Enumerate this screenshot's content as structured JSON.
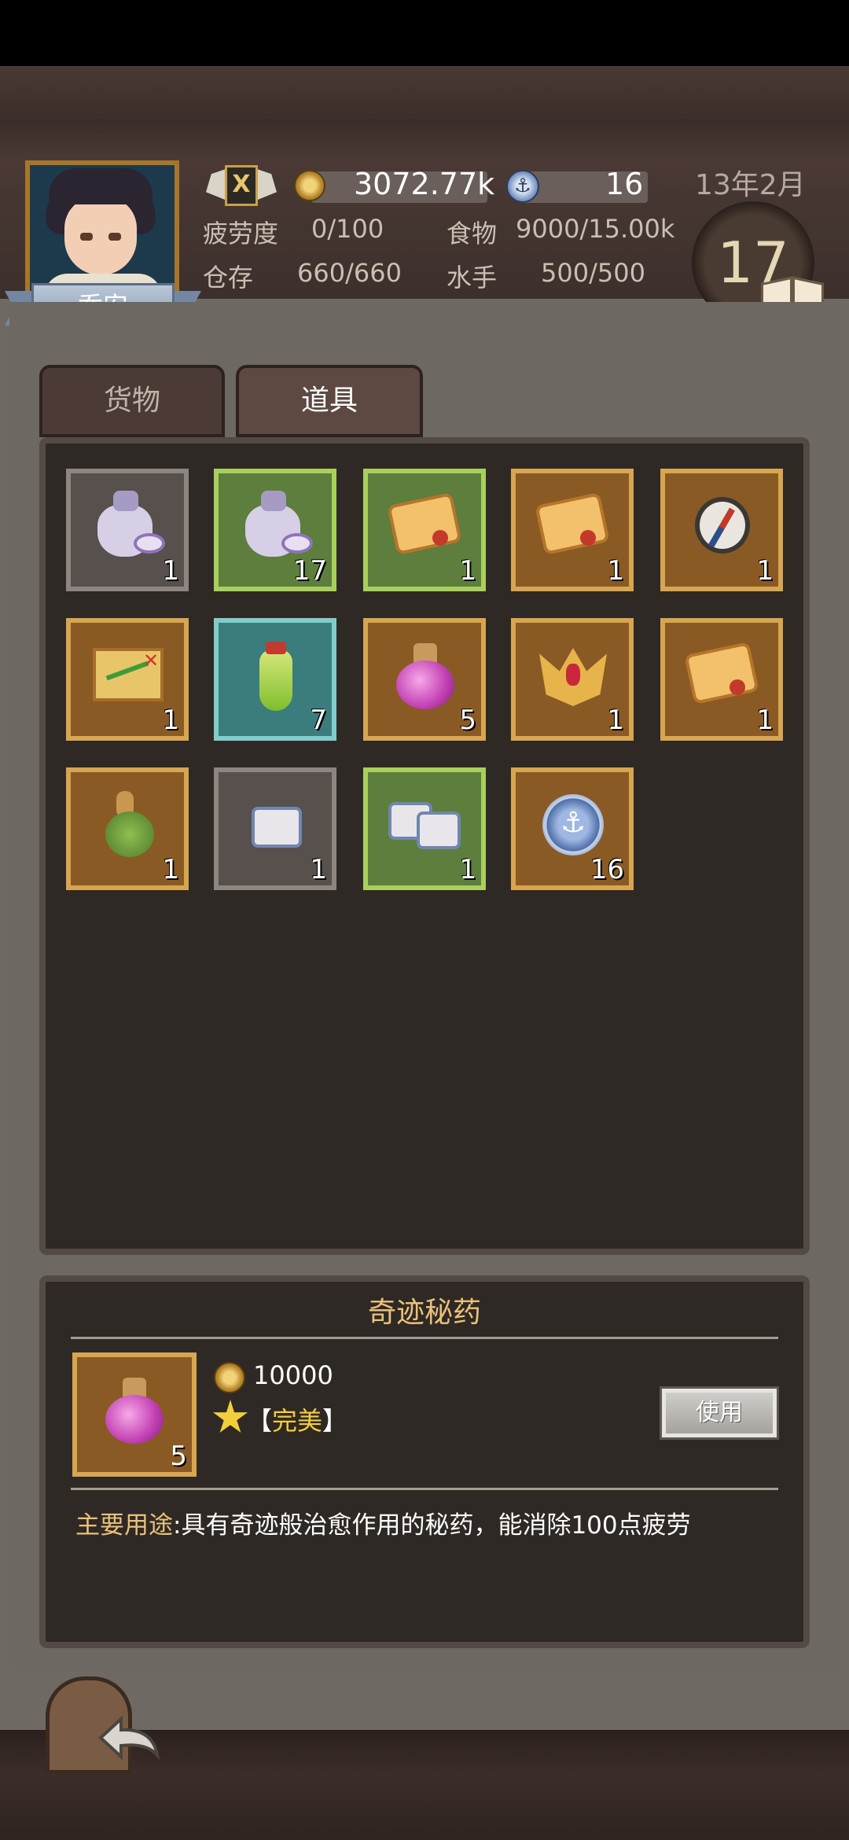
{
  "header": {
    "player_name": "乔安",
    "rank_letter": "X",
    "gold": "3072.77k",
    "medals": "16",
    "fatigue_label": "疲劳度",
    "fatigue_value": "0/100",
    "food_label": "食物",
    "food_value": "9000/15.00k",
    "storage_label": "仓存",
    "storage_value": "660/660",
    "sailors_label": "水手",
    "sailors_value": "500/500",
    "date": "13年2月",
    "day": "17"
  },
  "tabs": [
    {
      "label": "货物",
      "active": false
    },
    {
      "label": "道具",
      "active": true
    }
  ],
  "inventory": [
    {
      "icon": "pouch-icon",
      "rarity": "gray",
      "count": "1"
    },
    {
      "icon": "pouch-icon",
      "rarity": "green",
      "count": "17"
    },
    {
      "icon": "scroll-icon",
      "rarity": "green",
      "count": "1"
    },
    {
      "icon": "scroll-icon",
      "rarity": "gold",
      "count": "1"
    },
    {
      "icon": "compass-icon",
      "rarity": "gold",
      "count": "1"
    },
    {
      "icon": "treasure-map-icon",
      "rarity": "gold",
      "count": "1"
    },
    {
      "icon": "green-bottle-icon",
      "rarity": "teal",
      "count": "7"
    },
    {
      "icon": "potion-icon",
      "rarity": "gold",
      "count": "5"
    },
    {
      "icon": "crown-icon",
      "rarity": "gold",
      "count": "1"
    },
    {
      "icon": "scroll-icon",
      "rarity": "gold",
      "count": "1"
    },
    {
      "icon": "gourd-icon",
      "rarity": "gold",
      "count": "1"
    },
    {
      "icon": "can-icon",
      "rarity": "gray",
      "count": "1"
    },
    {
      "icon": "cans-icon",
      "rarity": "green",
      "count": "1"
    },
    {
      "icon": "anchor-medal-icon",
      "rarity": "gold",
      "count": "16"
    }
  ],
  "detail": {
    "title": "奇迹秘药",
    "count": "5",
    "price": "10000",
    "quality_open": "【",
    "quality": "完美",
    "quality_close": "】",
    "use_button": "使用",
    "usage_label": "主要用途",
    "usage_text": ":具有奇迹般治愈作用的秘药，能消除100点疲劳"
  },
  "colors": {
    "gray": "#57504c",
    "green": "#5d7e3d",
    "gold": "#8a5a25",
    "teal": "#3b7d7d",
    "accent_text": "#e9c27a"
  }
}
